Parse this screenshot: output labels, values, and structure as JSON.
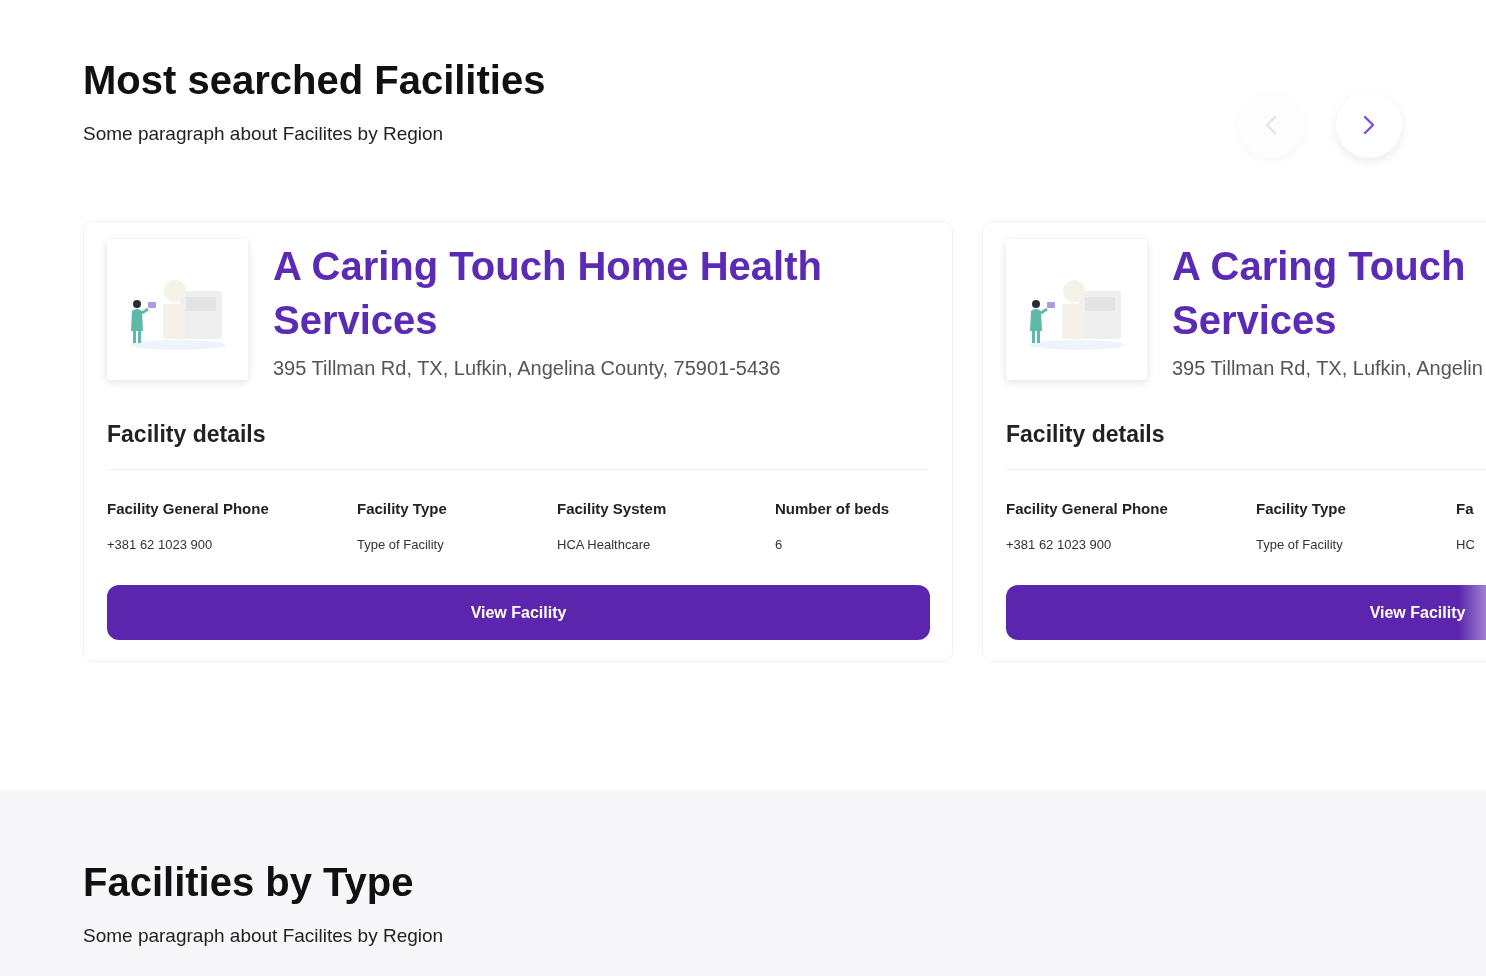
{
  "top_section": {
    "title": "Most searched Facilities",
    "paragraph": "Some paragraph about Facilites by Region",
    "nav": [
      {
        "kind": "prev",
        "disabled": true
      },
      {
        "kind": "next",
        "disabled": false
      }
    ],
    "cards": [
      {
        "title_lines": [
          "A Caring Touch Home Health",
          "Services"
        ],
        "address": "395 Tillman Rd, TX, Lufkin, Angelina County, 75901-5436",
        "details_title": "Facility details",
        "fields": [
          {
            "label": "Facility General Phone",
            "value": "+381 62 1023 900"
          },
          {
            "label": "Facility Type",
            "value": "Type of Facility"
          },
          {
            "label": "Facility System",
            "value": "HCA Healthcare"
          },
          {
            "label": "Number of beds",
            "value": "6"
          }
        ],
        "button": "View Facility"
      },
      {
        "title_lines": [
          "A Caring Touch",
          "Services"
        ],
        "address": "395 Tillman Rd, TX, Lufkin, Angelin",
        "details_title": "Facility details",
        "fields": [
          {
            "label": "Facility General Phone",
            "value": "+381 62 1023 900"
          },
          {
            "label": "Facility Type",
            "value": "Type of Facility"
          },
          {
            "label": "Fa",
            "value": "HC"
          }
        ],
        "button": "View Facility"
      }
    ]
  },
  "bottom_section": {
    "title": "Facilities by Type",
    "paragraph": "Some paragraph about Facilites by Region"
  }
}
